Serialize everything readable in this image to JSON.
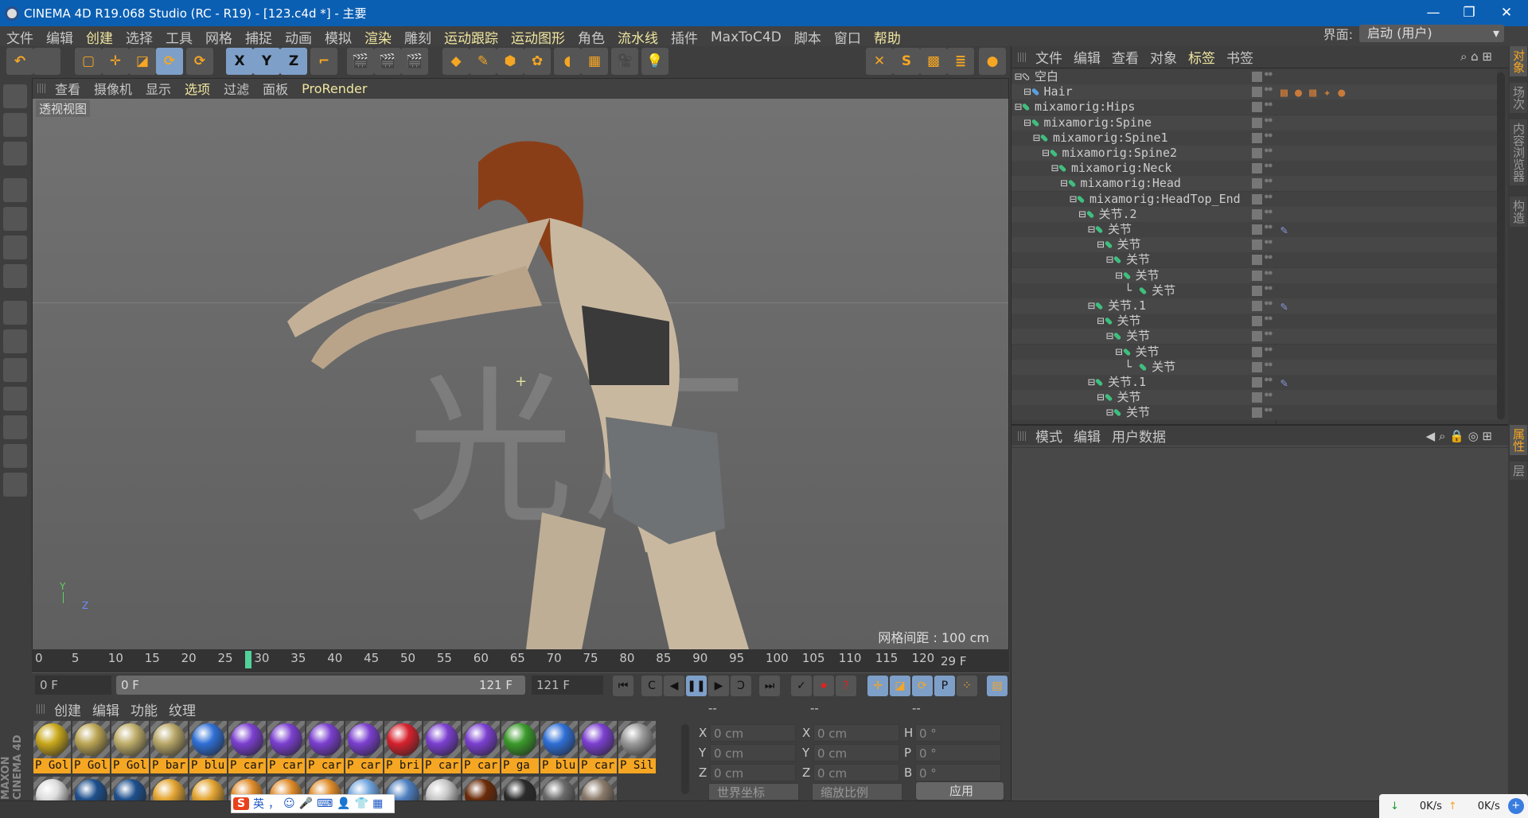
{
  "window": {
    "title": "CINEMA 4D R19.068 Studio (RC - R19) - [123.c4d *] - 主要",
    "minimize": "—",
    "maximize": "❐",
    "close": "✕"
  },
  "menu": [
    {
      "label": "文件"
    },
    {
      "label": "编辑"
    },
    {
      "label": "创建",
      "hl": true
    },
    {
      "label": "选择"
    },
    {
      "label": "工具"
    },
    {
      "label": "网格"
    },
    {
      "label": "捕捉"
    },
    {
      "label": "动画"
    },
    {
      "label": "模拟"
    },
    {
      "label": "渲染",
      "hl": true
    },
    {
      "label": "雕刻"
    },
    {
      "label": "运动跟踪",
      "hl": true
    },
    {
      "label": "运动图形",
      "hl": true
    },
    {
      "label": "角色"
    },
    {
      "label": "流水线",
      "hl": true
    },
    {
      "label": "插件"
    },
    {
      "label": "MaxToC4D"
    },
    {
      "label": "脚本"
    },
    {
      "label": "窗口"
    },
    {
      "label": "帮助",
      "hl": true
    }
  ],
  "interface": {
    "label": "界面:",
    "value": "启动 (用户)"
  },
  "toolbar": [
    {
      "icon": "undo-icon",
      "g": "↶"
    },
    {
      "icon": "redo-icon",
      "g": ""
    },
    {
      "icon": "live-select-icon",
      "g": "▢"
    },
    {
      "icon": "move-icon",
      "g": "✛"
    },
    {
      "icon": "scale-icon",
      "g": "◪"
    },
    {
      "icon": "rotate-icon",
      "g": "⟳",
      "sel": true
    },
    {
      "icon": "recent-tools-icon",
      "g": "⟳"
    },
    {
      "icon": "x-axis-icon",
      "g": "X",
      "sel": true
    },
    {
      "icon": "y-axis-icon",
      "g": "Y",
      "sel": true
    },
    {
      "icon": "z-axis-icon",
      "g": "Z",
      "sel": true
    },
    {
      "icon": "coordinate-system-icon",
      "g": "⌐"
    },
    {
      "icon": "render-view-icon",
      "g": "🎬"
    },
    {
      "icon": "render-picture-viewer-icon",
      "g": "🎬"
    },
    {
      "icon": "render-settings-icon",
      "g": "🎬"
    },
    {
      "icon": "cube-icon",
      "g": "◆"
    },
    {
      "icon": "pen-icon",
      "g": "✎"
    },
    {
      "icon": "subdivision-icon",
      "g": "⬢"
    },
    {
      "icon": "cloner-icon",
      "g": "✿"
    },
    {
      "icon": "deformer-icon",
      "g": "◖"
    },
    {
      "icon": "floor-icon",
      "g": "▦"
    },
    {
      "icon": "camera-icon",
      "g": "🎥"
    },
    {
      "icon": "light-icon",
      "g": "💡"
    },
    {
      "icon": "snap-icon",
      "g": "✕"
    },
    {
      "icon": "s-plugin-icon",
      "g": "S"
    },
    {
      "icon": "checker-icon",
      "g": "▩"
    },
    {
      "icon": "layers-icon",
      "g": "≣"
    },
    {
      "icon": "mograph-icon",
      "g": "●"
    }
  ],
  "viewport": {
    "menu": [
      {
        "label": "查看"
      },
      {
        "label": "摄像机"
      },
      {
        "label": "显示"
      },
      {
        "label": "选项",
        "hl": true
      },
      {
        "label": "过滤"
      },
      {
        "label": "面板"
      },
      {
        "label": "ProRender",
        "hl": true
      }
    ],
    "label": "透视视图",
    "grid": "网格间距 : 100 cm",
    "watermark": "光厂",
    "axis_y": "Y",
    "axis_z": "Z"
  },
  "timeline": {
    "ticks": [
      0,
      5,
      10,
      15,
      20,
      25,
      30,
      35,
      40,
      45,
      50,
      55,
      60,
      65,
      70,
      75,
      80,
      85,
      90,
      95,
      100,
      105,
      110,
      115,
      120
    ],
    "current": 29,
    "current_label": "29 F",
    "start": "0 F",
    "range_start": "0 F",
    "range_end": "121 F",
    "end": "121 F"
  },
  "materials": {
    "menu": [
      {
        "label": "创建",
        "hl": true
      },
      {
        "label": "编辑"
      },
      {
        "label": "功能"
      },
      {
        "label": "纹理"
      }
    ],
    "row1": [
      {
        "label": "P Gol",
        "color": "#c9a81c"
      },
      {
        "label": "P Gol",
        "color": "#bca655"
      },
      {
        "label": "P Gol",
        "color": "#bfae6a"
      },
      {
        "label": "P bar",
        "color": "#b8a768"
      },
      {
        "label": "P blu",
        "color": "#2f6fd6"
      },
      {
        "label": "P car",
        "color": "#7b3fd0"
      },
      {
        "label": "P car",
        "color": "#7b3fd0"
      },
      {
        "label": "P car",
        "color": "#7b3fd0"
      },
      {
        "label": "P car",
        "color": "#7b3fd0"
      },
      {
        "label": "P bri",
        "color": "#d6212d"
      },
      {
        "label": "P car",
        "color": "#7b3fd0"
      },
      {
        "label": "P car",
        "color": "#7b3fd0"
      },
      {
        "label": "P  ga",
        "color": "#3a9a2a"
      },
      {
        "label": "P blu",
        "color": "#2f6fd6"
      },
      {
        "label": "P car",
        "color": "#7b3fd0"
      },
      {
        "label": "P Sil",
        "color": "#9a9a9a"
      }
    ],
    "row2": [
      "#dcdcdc",
      "#1d4f8c",
      "#1d4f8c",
      "#e3a532",
      "#e3a532",
      "#e08c2a",
      "#e08c2a",
      "#e08c2a",
      "#6fa4de",
      "#4d7fc0",
      "#c8c8c8",
      "#6a2a08",
      "#2a2a2a",
      "#6a6a6a",
      "#8a7a6a"
    ]
  },
  "coords": {
    "headers": [
      "--",
      "--",
      "--"
    ],
    "rows": [
      {
        "a": "X",
        "av": "0 cm",
        "b": "X",
        "bv": "0 cm",
        "c": "H",
        "cv": "0 °"
      },
      {
        "a": "Y",
        "av": "0 cm",
        "b": "Y",
        "bv": "0 cm",
        "c": "P",
        "cv": "0 °"
      },
      {
        "a": "Z",
        "av": "0 cm",
        "b": "Z",
        "bv": "0 cm",
        "c": "B",
        "cv": "0 °"
      }
    ],
    "mode1": "世界坐标",
    "mode2": "缩放比例",
    "apply": "应用"
  },
  "object_manager": {
    "menu": [
      {
        "label": "文件"
      },
      {
        "label": "编辑"
      },
      {
        "label": "查看"
      },
      {
        "label": "对象"
      },
      {
        "label": "标签",
        "hl": true
      },
      {
        "label": "书签"
      }
    ],
    "objects": [
      {
        "name": "空白",
        "level": 0,
        "type": "null"
      },
      {
        "name": "Hair",
        "level": 1,
        "type": "hair",
        "tags": "hair"
      },
      {
        "name": "mixamorig:Hips",
        "level": 0
      },
      {
        "name": "mixamorig:Spine",
        "level": 1
      },
      {
        "name": "mixamorig:Spine1",
        "level": 2
      },
      {
        "name": "mixamorig:Spine2",
        "level": 3
      },
      {
        "name": "mixamorig:Neck",
        "level": 4
      },
      {
        "name": "mixamorig:Head",
        "level": 5
      },
      {
        "name": "mixamorig:HeadTop_End",
        "level": 6
      },
      {
        "name": "关节.2",
        "level": 7
      },
      {
        "name": "关节",
        "level": 8,
        "tags": "ik"
      },
      {
        "name": "关节",
        "level": 9
      },
      {
        "name": "关节",
        "level": 10
      },
      {
        "name": "关节",
        "level": 11
      },
      {
        "name": "关节",
        "level": 12
      },
      {
        "name": "关节.1",
        "level": 8,
        "tags": "ik"
      },
      {
        "name": "关节",
        "level": 9
      },
      {
        "name": "关节",
        "level": 10
      },
      {
        "name": "关节",
        "level": 11
      },
      {
        "name": "关节",
        "level": 12
      },
      {
        "name": "关节.1",
        "level": 8,
        "tags": "ik"
      },
      {
        "name": "关节",
        "level": 9
      },
      {
        "name": "关节",
        "level": 10
      }
    ]
  },
  "attributes": {
    "menu": [
      {
        "label": "模式"
      },
      {
        "label": "编辑"
      },
      {
        "label": "用户数据"
      }
    ]
  },
  "side_tabs_top": [
    {
      "label": "对象",
      "act": true
    },
    {
      "label": "场次"
    },
    {
      "label": "内容浏览器"
    },
    {
      "label": "构造"
    }
  ],
  "side_tabs_bottom": [
    {
      "label": "属性",
      "act": true
    },
    {
      "label": "层"
    }
  ],
  "branding": "MAXON CINEMA 4D",
  "ime": {
    "lang": "英",
    "punct": "，"
  },
  "network": {
    "down": "0K/s",
    "up": "0K/s"
  },
  "colors": {
    "accent": "#f0e6a0",
    "selected_tool": "#7e9fc8",
    "material_label": "#f5a623",
    "titlebar": "#0b5fb3",
    "current_frame": "#52d19a"
  }
}
